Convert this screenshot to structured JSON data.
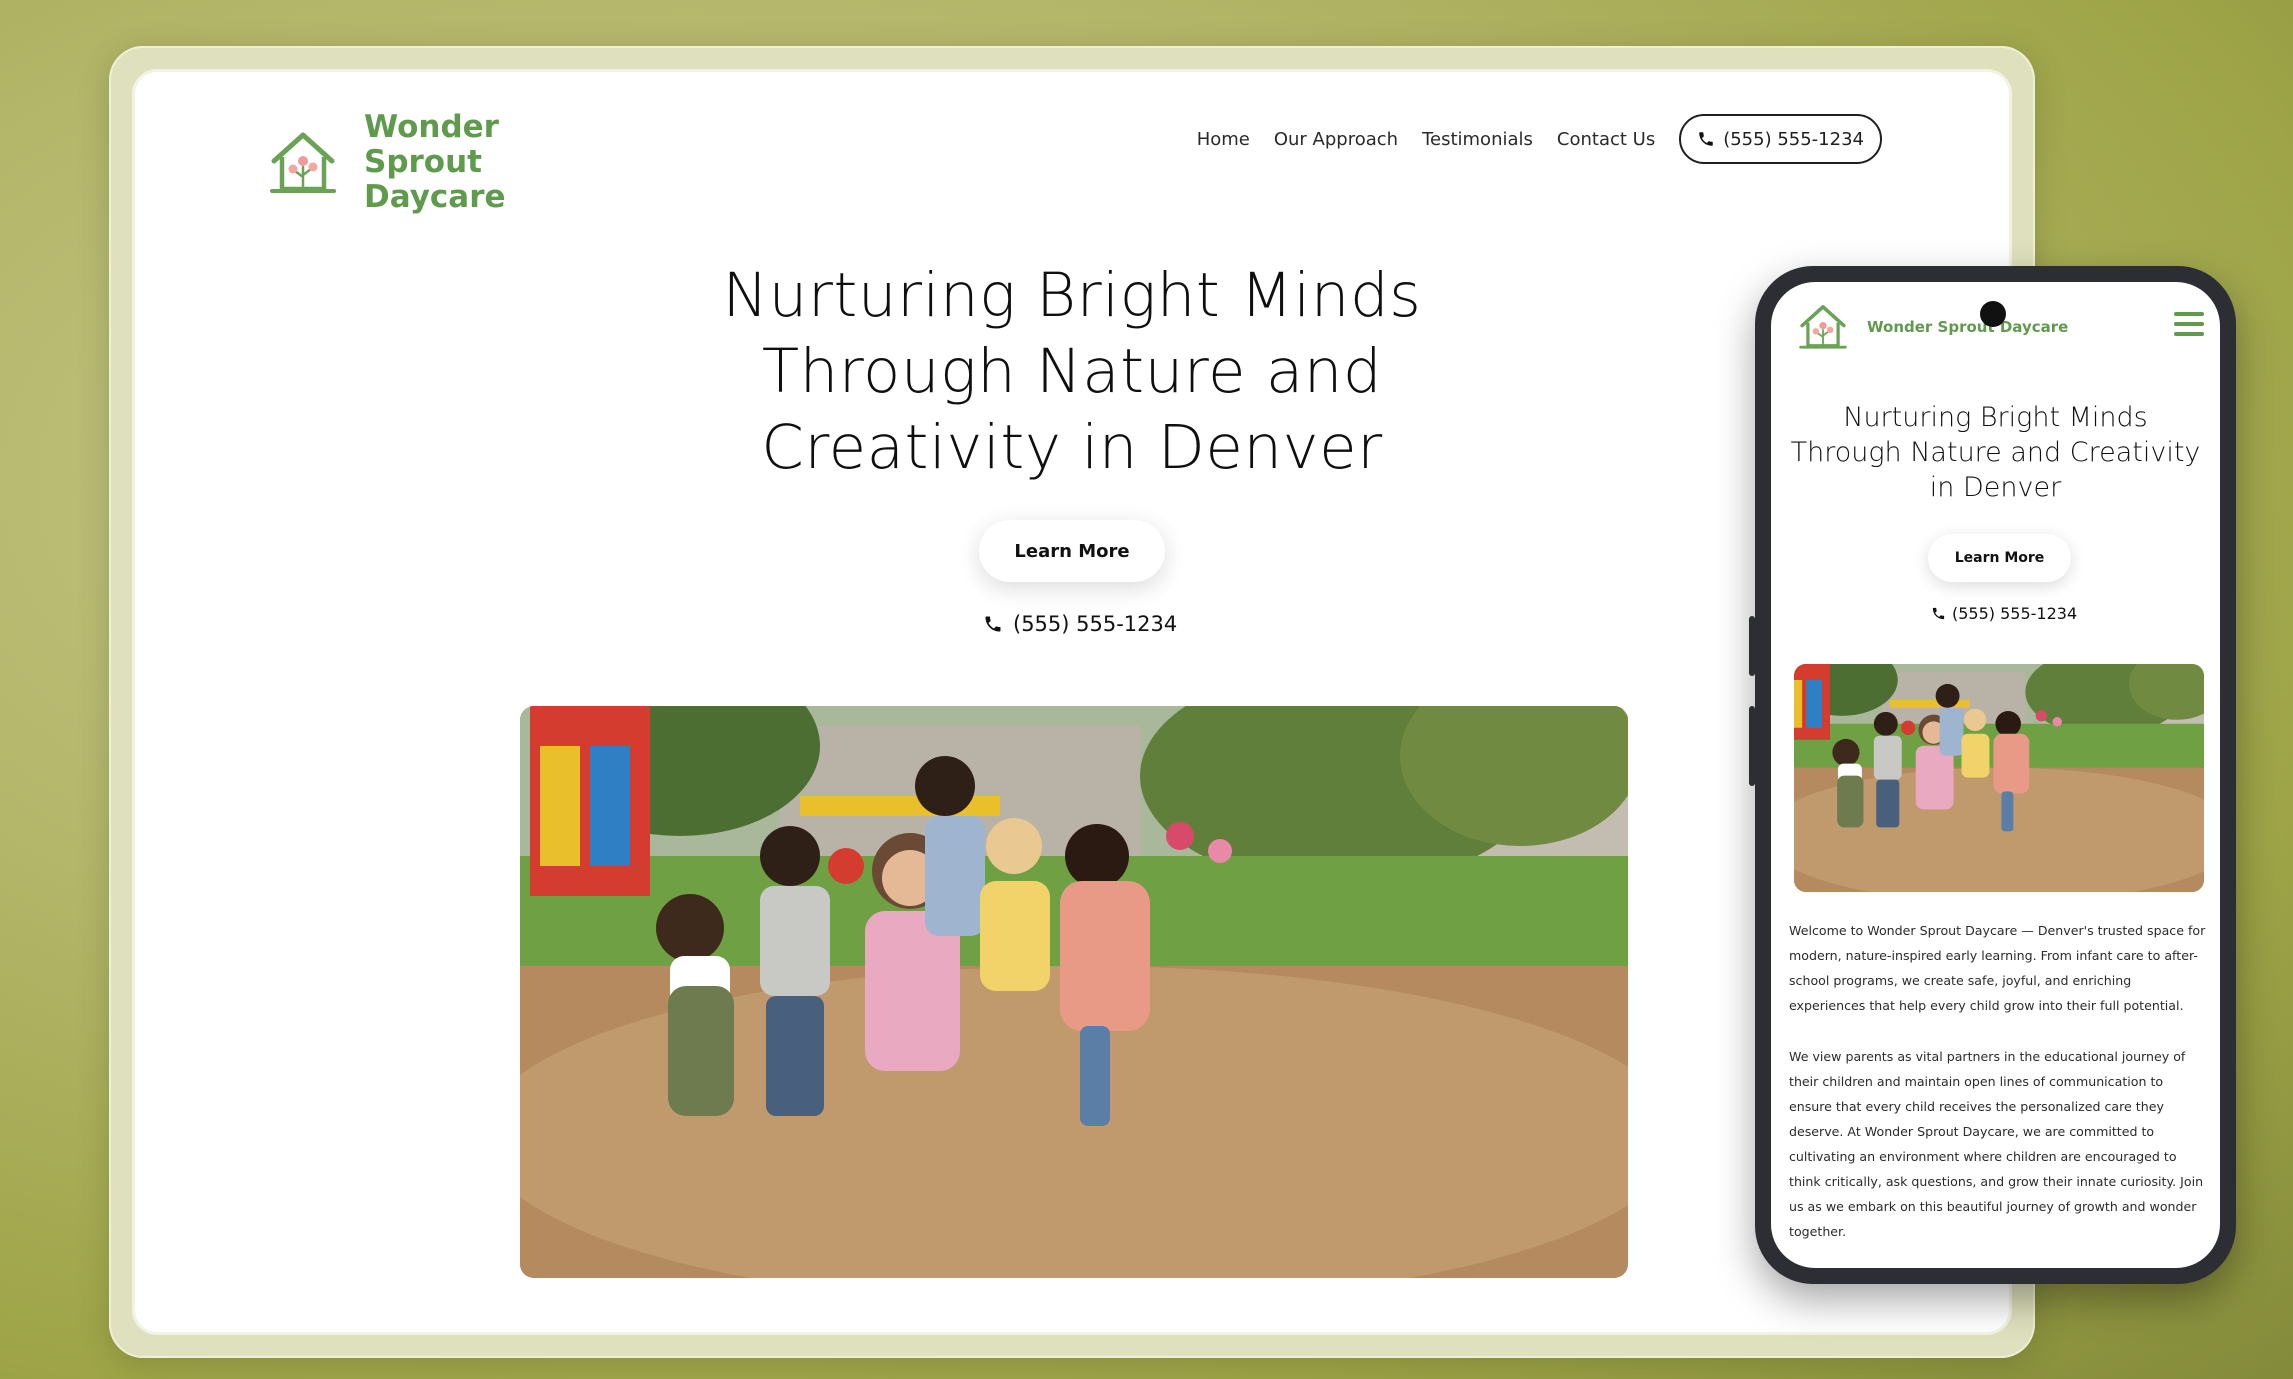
{
  "brand": {
    "name": "Wonder Sprout Daycare",
    "accent_color": "#5f9a4d",
    "logo_icon": "house-heart-flower-icon"
  },
  "desktop": {
    "nav": {
      "items": [
        {
          "label": "Home"
        },
        {
          "label": "Our Approach"
        },
        {
          "label": "Testimonials"
        },
        {
          "label": "Contact Us"
        }
      ],
      "phone_label": "(555) 555-1234",
      "phone_icon": "phone-icon"
    },
    "hero": {
      "title": "Nurturing Bright Minds Through Nature and Creativity in Denver",
      "button_label": "Learn More",
      "phone_label": "(555) 555-1234",
      "image_icon": "children-playground-photo"
    }
  },
  "mobile": {
    "brand_name": "Wonder Sprout Daycare",
    "menu_icon": "hamburger-menu-icon",
    "hero": {
      "title": "Nurturing Bright Minds Through Nature and Creativity in Denver",
      "button_label": "Learn More",
      "phone_label": "(555) 555-1234"
    },
    "paragraphs": [
      "Welcome to Wonder Sprout Daycare — Denver's trusted space for modern, nature-inspired early learning. From infant care to after-school programs, we create safe, joyful, and enriching experiences that help every child grow into their full potential.",
      "We view parents as vital partners in the educational journey of their children and maintain open lines of communication to ensure that every child receives the personalized care they deserve. At Wonder Sprout Daycare, we are committed to cultivating an environment where children are encouraged to think critically, ask questions, and grow their innate curiosity. Join us as we embark on this beautiful journey of growth and wonder together."
    ]
  }
}
